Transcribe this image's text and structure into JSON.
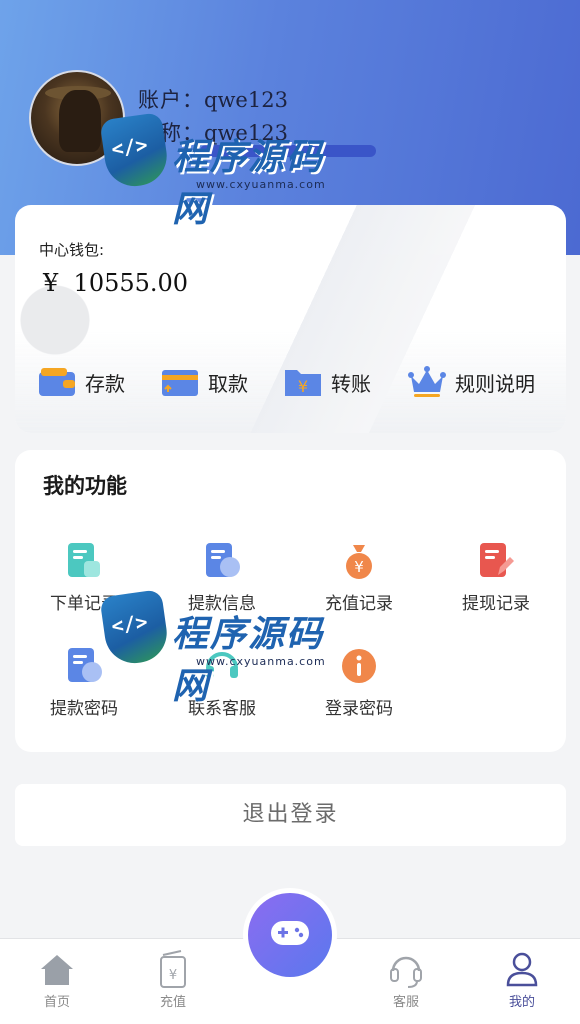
{
  "profile": {
    "account_label": "账户：",
    "account_value": "qwe123",
    "nickname_label": "昵称：",
    "nickname_value": "qwe123"
  },
  "wallet": {
    "label": "中心钱包:",
    "currency": "¥",
    "amount": "10555.00",
    "actions": [
      {
        "label": "存款",
        "icon": "wallet-icon"
      },
      {
        "label": "取款",
        "icon": "card-withdraw-icon"
      },
      {
        "label": "转账",
        "icon": "yen-folder-icon"
      },
      {
        "label": "规则说明",
        "icon": "crown-icon"
      }
    ]
  },
  "functions": {
    "title": "我的功能",
    "items": [
      {
        "label": "下单记录",
        "icon": "order-record-icon",
        "color": "#4cc8c0"
      },
      {
        "label": "提款信息",
        "icon": "withdraw-info-icon",
        "color": "#5b86e5"
      },
      {
        "label": "充值记录",
        "icon": "money-bag-icon",
        "color": "#f0874a"
      },
      {
        "label": "提现记录",
        "icon": "edit-document-icon",
        "color": "#e8574f"
      },
      {
        "label": "提款密码",
        "icon": "withdraw-password-icon",
        "color": "#5b86e5"
      },
      {
        "label": "联系客服",
        "icon": "customer-service-icon",
        "color": "#4cc8c0"
      },
      {
        "label": "登录密码",
        "icon": "info-icon",
        "color": "#f0874a"
      }
    ]
  },
  "logout": {
    "label": "退出登录"
  },
  "tabbar": {
    "items": [
      {
        "label": "首页",
        "icon": "home-icon"
      },
      {
        "label": "充值",
        "icon": "recharge-icon"
      },
      {
        "label": "客服",
        "icon": "headset-icon"
      },
      {
        "label": "我的",
        "icon": "user-icon"
      }
    ],
    "center_icon": "gamepad-icon",
    "active_color": "#4a4f9a"
  },
  "watermark": {
    "brand": "程序源码网",
    "url": "www.cxyuanma.com"
  },
  "colors": {
    "header_start": "#6ea3ea",
    "header_end": "#4c6ad2",
    "fab_start": "#8c6cf0",
    "fab_end": "#5a78ee"
  }
}
